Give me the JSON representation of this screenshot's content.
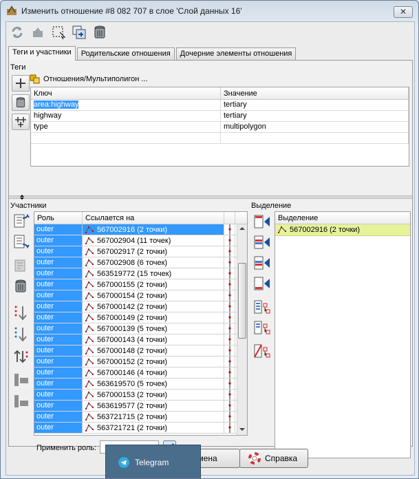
{
  "window": {
    "title": "Изменить отношение #8 082 707 в слое 'Слой данных 16'",
    "close_glyph": "✕"
  },
  "tabs": [
    {
      "label": "Теги и участники"
    },
    {
      "label": "Родительские отношения"
    },
    {
      "label": "Дочерние элементы отношения"
    }
  ],
  "tags": {
    "section_label": "Теги",
    "preset_label": "Отношения/Мультиполигон ...",
    "col_key": "Ключ",
    "col_value": "Значение",
    "rows": [
      {
        "key": "area:highway",
        "value": "tertiary"
      },
      {
        "key": "highway",
        "value": "tertiary"
      },
      {
        "key": "type",
        "value": "multipolygon"
      }
    ]
  },
  "members": {
    "section_label": "Участники",
    "col_role": "Роль",
    "col_ref": "Ссылается на",
    "rows": [
      {
        "role": "outer",
        "ref": "567002916 (2 точки)"
      },
      {
        "role": "outer",
        "ref": "567002904 (11 точек)"
      },
      {
        "role": "outer",
        "ref": "567002917 (2 точки)"
      },
      {
        "role": "outer",
        "ref": "567002908 (6 точек)"
      },
      {
        "role": "outer",
        "ref": "563519772 (15 точек)"
      },
      {
        "role": "outer",
        "ref": "567000155 (2 точки)"
      },
      {
        "role": "outer",
        "ref": "567000154 (2 точки)"
      },
      {
        "role": "outer",
        "ref": "567000142 (2 точки)"
      },
      {
        "role": "outer",
        "ref": "567000149 (2 точки)"
      },
      {
        "role": "outer",
        "ref": "567000139 (5 точек)"
      },
      {
        "role": "outer",
        "ref": "567000143 (4 точки)"
      },
      {
        "role": "outer",
        "ref": "567000148 (2 точки)"
      },
      {
        "role": "outer",
        "ref": "567000152 (2 точки)"
      },
      {
        "role": "outer",
        "ref": "567000146 (4 точки)"
      },
      {
        "role": "outer",
        "ref": "563619570 (5 точек)"
      },
      {
        "role": "outer",
        "ref": "567000153 (2 точки)"
      },
      {
        "role": "outer",
        "ref": "563619577 (2 точки)"
      },
      {
        "role": "outer",
        "ref": "563721715 (2 точки)"
      },
      {
        "role": "outer",
        "ref": "563721721 (2 точки)"
      }
    ],
    "apply_role_label": "Применить роль:",
    "apply_role_value": ""
  },
  "selection": {
    "section_label": "Выделение",
    "col_header": "Выделение",
    "rows": [
      {
        "ref": "567002916 (2 точки)"
      }
    ]
  },
  "buttons": {
    "cancel_label": "тмена",
    "help_label": "Справка"
  },
  "taskbar": {
    "telegram_label": "Telegram"
  },
  "colors": {
    "selection_blue": "#3399ff",
    "selection_yellow": "#e6f39a"
  }
}
